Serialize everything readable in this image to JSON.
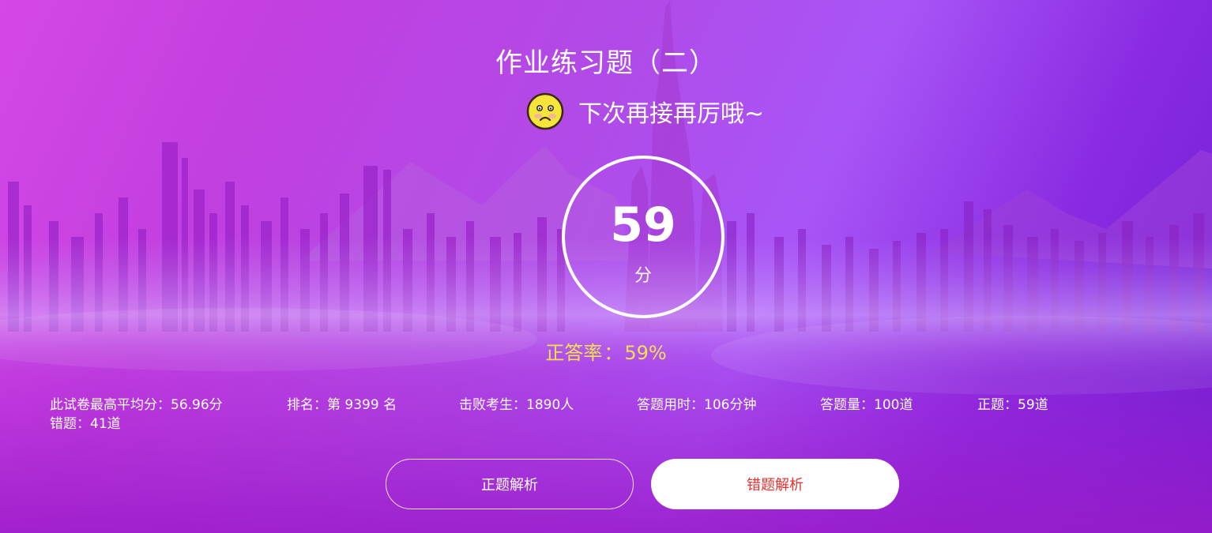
{
  "exam": {
    "title": "作业练习题（二）",
    "encouragement": "下次再接再厉哦~",
    "score": "59",
    "score_unit": "分",
    "accuracy_label": "正答率",
    "accuracy_sep": "：",
    "accuracy_value": "59%"
  },
  "stats": {
    "highest_avg": "此试卷最高平均分：56.96分",
    "rank": "排名：第 9399 名",
    "defeated": "击败考生：1890人",
    "time_used": "答题用时：106分钟",
    "total_questions": "答题量：100道",
    "correct_count": "正题：59道",
    "wrong_count": "错题：41道"
  },
  "actions": {
    "correct_analysis": "正题解析",
    "wrong_analysis": "错题解析"
  },
  "icons": {
    "emoji": "sad-face-icon"
  },
  "colors": {
    "accuracy": "#f4e04d",
    "wrong_button_text": "#e5322d",
    "emoji_face": "#f5e53a"
  }
}
